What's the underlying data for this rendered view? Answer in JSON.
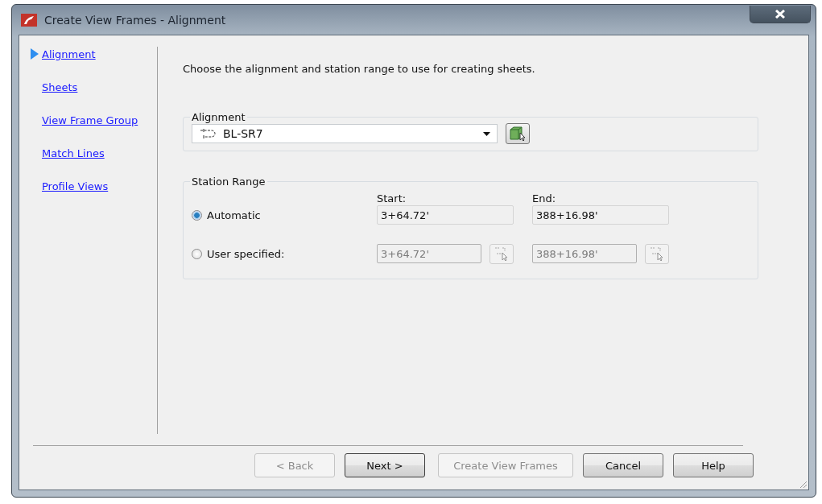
{
  "window": {
    "title": "Create View Frames - Alignment"
  },
  "nav": [
    {
      "label": "Alignment",
      "selected": true
    },
    {
      "label": "Sheets",
      "selected": false
    },
    {
      "label": "View Frame Group",
      "selected": false
    },
    {
      "label": "Match Lines",
      "selected": false
    },
    {
      "label": "Profile Views",
      "selected": false
    }
  ],
  "instruction": "Choose the alignment and station range to use for creating sheets.",
  "alignment": {
    "legend": "Alignment",
    "value": "BL-SR7"
  },
  "station_range": {
    "legend": "Station Range",
    "start_label": "Start:",
    "end_label": "End:",
    "options": [
      {
        "label": "Automatic",
        "selected": true,
        "kind": "readout",
        "disabled": false,
        "start": "3+64.72'",
        "end": "388+16.98'"
      },
      {
        "label": "User specified:",
        "selected": false,
        "kind": "input",
        "disabled": true,
        "start": "3+64.72'",
        "end": "388+16.98'"
      }
    ]
  },
  "buttons": [
    {
      "label": "< Back",
      "disabled": true,
      "default": false
    },
    {
      "label": "Next >",
      "disabled": false,
      "default": true
    },
    {
      "label": "Create View Frames",
      "disabled": true,
      "default": false
    },
    {
      "label": "Cancel",
      "disabled": false,
      "default": false
    },
    {
      "label": "Help",
      "disabled": false,
      "default": false
    }
  ]
}
